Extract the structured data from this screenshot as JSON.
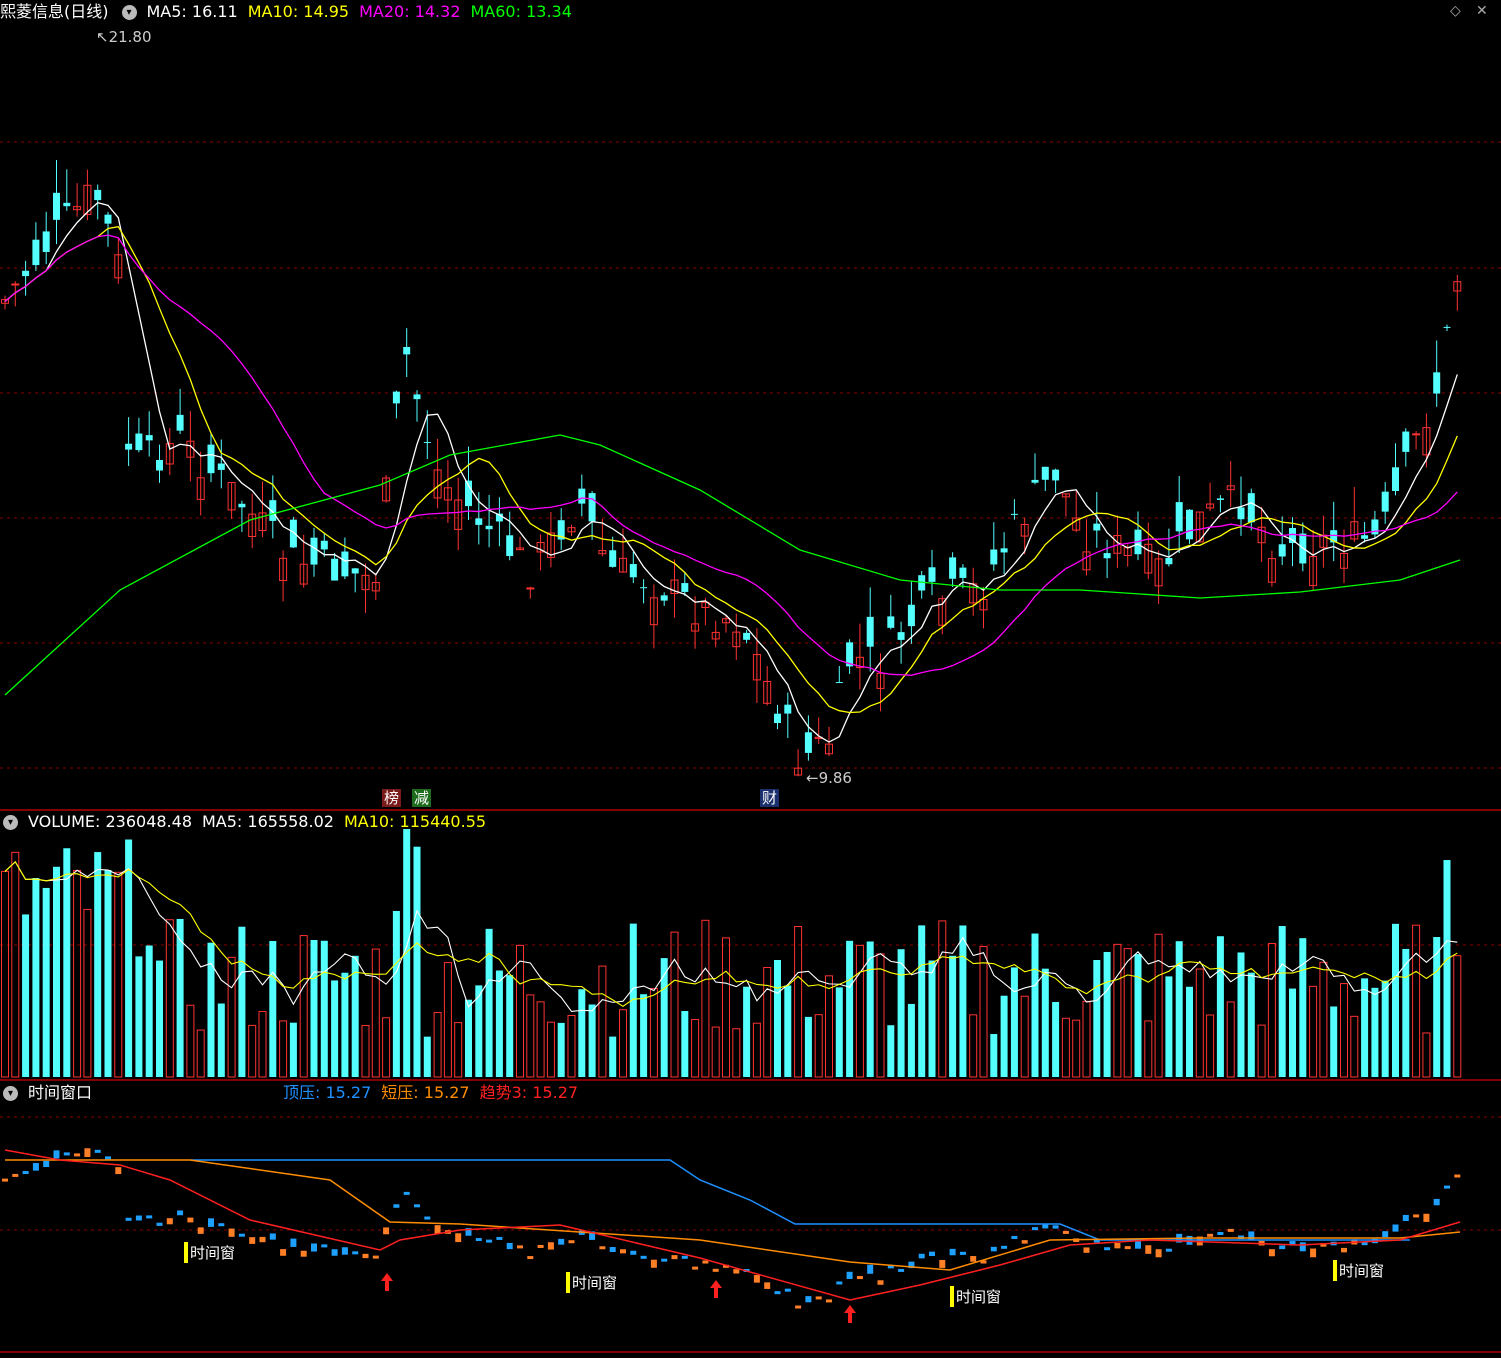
{
  "main": {
    "title": "熙菱信息(日线)",
    "ma": [
      {
        "label": "MA5: 16.11",
        "color": "#ffffff"
      },
      {
        "label": "MA10: 14.95",
        "color": "#ffff00"
      },
      {
        "label": "MA20: 14.32",
        "color": "#ff00ff"
      },
      {
        "label": "MA60: 13.34",
        "color": "#00ff00"
      }
    ],
    "high_label": "21.80",
    "low_label": "9.86",
    "tag1": "榜",
    "tag2": "减",
    "tag3": "财"
  },
  "volume": {
    "title": "VOLUME: 236048.48",
    "ma5": "MA5: 165558.02",
    "ma10": "MA10: 115440.55"
  },
  "indicator": {
    "title": "时间窗口",
    "top": "顶压: 15.27",
    "short": "短压: 15.27",
    "trend": "趋势3: 15.27",
    "window_label": "时间窗"
  },
  "colors": {
    "up": "#ff3232",
    "down": "#54ffff",
    "grid": "#8b0000",
    "ma5": "#ffffff",
    "ma10": "#ffff00",
    "ma20": "#ff00ff",
    "ma60": "#00ff00",
    "top_line": "#1e90ff",
    "short_line": "#ff8c00",
    "trend_line": "#ff2020"
  },
  "icons": {
    "settings": "diamond-icon",
    "close": "close-icon"
  },
  "chart_data": {
    "type": "candlestick",
    "price_high": 21.8,
    "price_low": 9.86,
    "ma_last": {
      "ma5": 16.11,
      "ma10": 14.95,
      "ma20": 14.32,
      "ma60": 13.34
    },
    "volume_last": 236048.48,
    "volume_ma5": 165558.02,
    "volume_ma10": 115440.55,
    "indicator_last": {
      "top": 15.27,
      "short": 15.27,
      "trend": 15.27
    }
  }
}
